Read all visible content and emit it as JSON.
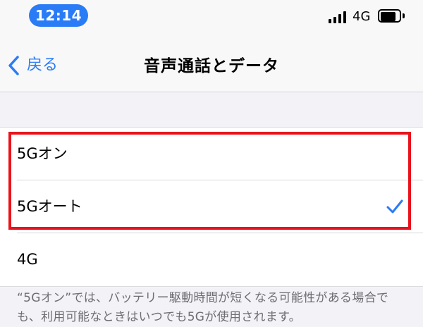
{
  "status_bar": {
    "time": "12:14",
    "network": "4G",
    "accent_color": "#2a7cf6"
  },
  "nav": {
    "back_label": "戻る",
    "title": "音声通話とデータ"
  },
  "options": [
    {
      "label": "5Gオン",
      "selected": false
    },
    {
      "label": "5Gオート",
      "selected": true
    },
    {
      "label": "4G",
      "selected": false
    }
  ],
  "footer_note": "“5Gオン”では、バッテリー駆動時間が短くなる可能性がある場合でも、利用可能なときはいつでも5Gが使用されます。",
  "colors": {
    "highlight": "#e8131c",
    "background": "#f2f2f7"
  }
}
